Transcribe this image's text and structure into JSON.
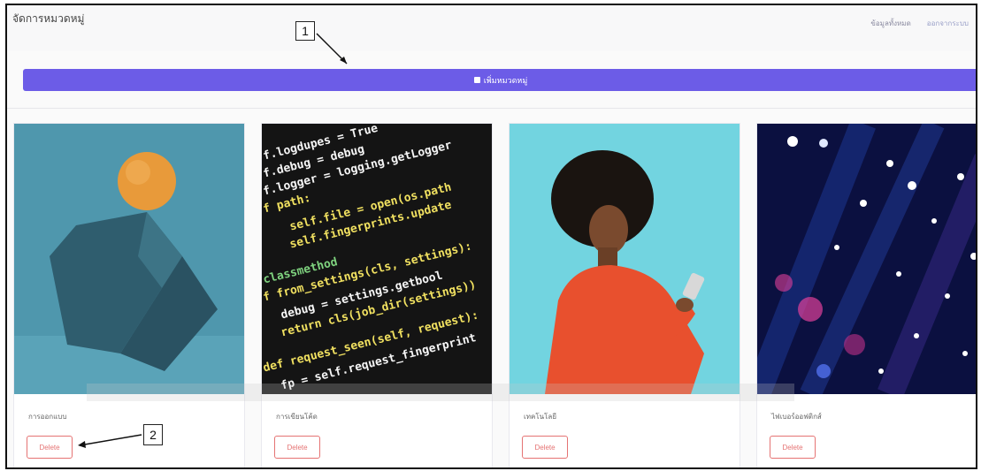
{
  "header": {
    "title": "จัดการหมวดหมู่",
    "links": [
      "ข้อมูลทั้งหมด",
      "ออกจากระบบ"
    ]
  },
  "add_button": {
    "label": "เพิ่มหมวดหมู่",
    "icon": "plus-square-icon"
  },
  "cards": [
    {
      "label": "การออกแบบ",
      "delete_label": "Delete",
      "image": "abstract-shapes"
    },
    {
      "label": "การเขียนโค้ด",
      "delete_label": "Delete",
      "image": "source-code"
    },
    {
      "label": "เทคโนโลยี",
      "delete_label": "Delete",
      "image": "person-with-phone"
    },
    {
      "label": "ไฟเบอร์ออฟติกส์",
      "delete_label": "Delete",
      "image": "fiber-optics"
    }
  ],
  "callouts": [
    "1",
    "2"
  ],
  "colors": {
    "accent": "#6c5ce7",
    "danger": "#e57373"
  }
}
